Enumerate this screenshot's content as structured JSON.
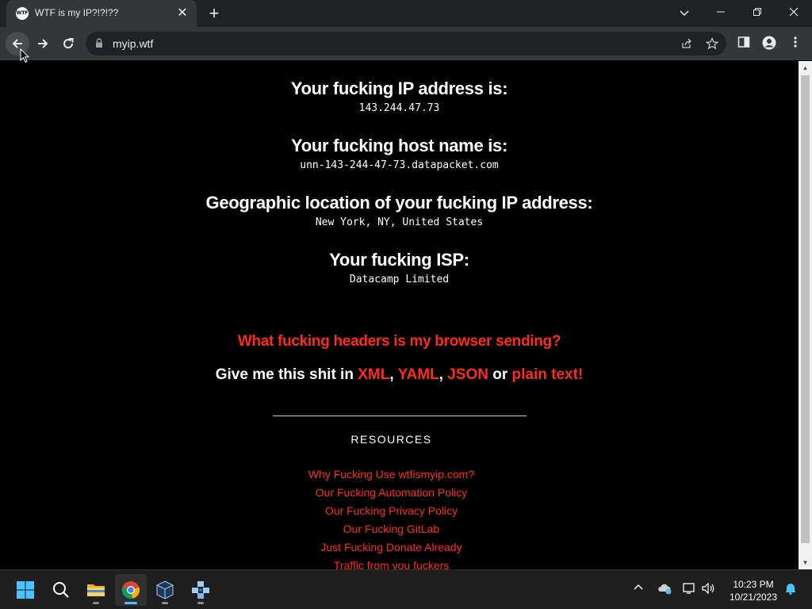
{
  "browser": {
    "tab_title": "WTF is my IP?!?!??",
    "tab_favicon_text": "WTF",
    "url": "myip.wtf"
  },
  "page": {
    "ip_heading": "Your fucking IP address is:",
    "ip_value": "143.244.47.73",
    "host_heading": "Your fucking host name is:",
    "host_value": "unn-143-244-47-73.datapacket.com",
    "geo_heading": "Geographic location of your fucking IP address:",
    "geo_value": "New York, NY, United States",
    "isp_heading": "Your fucking ISP:",
    "isp_value": "Datacamp Limited",
    "headers_link": "What fucking headers is my browser sending?",
    "formats_prefix": "Give me this shit in ",
    "format_xml": "XML",
    "comma1": ", ",
    "format_yaml": "YAML",
    "comma2": ", ",
    "format_json": "JSON",
    "or_text": " or ",
    "format_plain": "plain text!",
    "resources_title": "RESOURCES",
    "resources": [
      "Why Fucking Use wtfismyip.com?",
      "Our Fucking Automation Policy",
      "Our Fucking Privacy Policy",
      "Our Fucking GitLab",
      "Just Fucking Donate Already",
      "Traffic from you fuckers"
    ]
  },
  "taskbar": {
    "time": "10:23 PM",
    "date": "10/21/2023"
  },
  "colors": {
    "accent_red": "#ff2a1e",
    "page_background": "#000000",
    "chrome_dark": "#202124"
  }
}
